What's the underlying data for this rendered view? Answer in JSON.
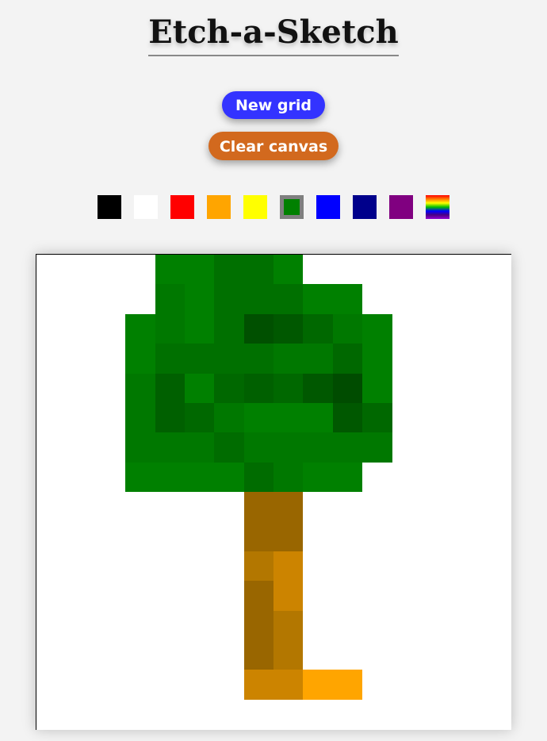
{
  "header": {
    "title": "Etch-a-Sketch"
  },
  "controls": {
    "new_grid_label": "New grid",
    "clear_canvas_label": "Clear canvas",
    "new_grid_color": "#3333ff",
    "clear_canvas_color": "#d2691e"
  },
  "palette": {
    "selected": "green",
    "colors": [
      {
        "name": "black",
        "hex": "#000000"
      },
      {
        "name": "white",
        "hex": "#ffffff"
      },
      {
        "name": "red",
        "hex": "#ff0000"
      },
      {
        "name": "orange",
        "hex": "#ffa500"
      },
      {
        "name": "yellow",
        "hex": "#ffff00"
      },
      {
        "name": "green",
        "hex": "#008000"
      },
      {
        "name": "blue",
        "hex": "#0000ff"
      },
      {
        "name": "navy",
        "hex": "#00008b"
      },
      {
        "name": "purple",
        "hex": "#800080"
      },
      {
        "name": "rainbow",
        "hex": "rainbow"
      }
    ]
  },
  "canvas": {
    "grid_size": 16,
    "background": "#ffffff",
    "rows": [
      [
        "",
        "",
        "",
        "",
        "#008000",
        "#008000",
        "#007000",
        "#007000",
        "#008000",
        "",
        "",
        "",
        "",
        "",
        "",
        ""
      ],
      [
        "",
        "",
        "",
        "",
        "#007800",
        "#008000",
        "#007000",
        "#007000",
        "#007000",
        "#008000",
        "#008000",
        "",
        "",
        "",
        "",
        ""
      ],
      [
        "",
        "",
        "",
        "#008000",
        "#007800",
        "#008000",
        "#007000",
        "#005000",
        "#005800",
        "#006800",
        "#007800",
        "#008000",
        "",
        "",
        "",
        ""
      ],
      [
        "",
        "",
        "",
        "#008000",
        "#007000",
        "#007000",
        "#007000",
        "#007000",
        "#007800",
        "#007800",
        "#006800",
        "#008000",
        "",
        "",
        "",
        ""
      ],
      [
        "",
        "",
        "",
        "#007800",
        "#006000",
        "#008000",
        "#006800",
        "#006000",
        "#006800",
        "#005800",
        "#004c00",
        "#008000",
        "",
        "",
        "",
        ""
      ],
      [
        "",
        "",
        "",
        "#007800",
        "#006000",
        "#006800",
        "#007800",
        "#008000",
        "#008000",
        "#008000",
        "#005800",
        "#006800",
        "",
        "",
        "",
        ""
      ],
      [
        "",
        "",
        "",
        "#007800",
        "#007800",
        "#007800",
        "#006c00",
        "#007800",
        "#007800",
        "#007800",
        "#007800",
        "#007800",
        "",
        "",
        "",
        ""
      ],
      [
        "",
        "",
        "",
        "#008000",
        "#008000",
        "#008000",
        "#008000",
        "#006c00",
        "#007800",
        "#008000",
        "#008000",
        "",
        "",
        "",
        "",
        ""
      ],
      [
        "",
        "",
        "",
        "",
        "",
        "",
        "",
        "#996600",
        "#996600",
        "",
        "",
        "",
        "",
        "",
        "",
        ""
      ],
      [
        "",
        "",
        "",
        "",
        "",
        "",
        "",
        "#996600",
        "#996600",
        "",
        "",
        "",
        "",
        "",
        "",
        ""
      ],
      [
        "",
        "",
        "",
        "",
        "",
        "",
        "",
        "#b37700",
        "#cc8400",
        "",
        "",
        "",
        "",
        "",
        "",
        ""
      ],
      [
        "",
        "",
        "",
        "",
        "",
        "",
        "",
        "#996600",
        "#cc8400",
        "",
        "",
        "",
        "",
        "",
        "",
        ""
      ],
      [
        "",
        "",
        "",
        "",
        "",
        "",
        "",
        "#996600",
        "#b37700",
        "",
        "",
        "",
        "",
        "",
        "",
        ""
      ],
      [
        "",
        "",
        "",
        "",
        "",
        "",
        "",
        "#996600",
        "#b37700",
        "",
        "",
        "",
        "",
        "",
        "",
        ""
      ],
      [
        "",
        "",
        "",
        "",
        "",
        "",
        "",
        "#cc8400",
        "#cc8400",
        "#ffa500",
        "#ffa500",
        "",
        "",
        "",
        "",
        ""
      ],
      [
        "",
        "",
        "",
        "",
        "",
        "",
        "",
        "",
        "",
        "",
        "",
        "",
        "",
        "",
        "",
        ""
      ]
    ]
  }
}
